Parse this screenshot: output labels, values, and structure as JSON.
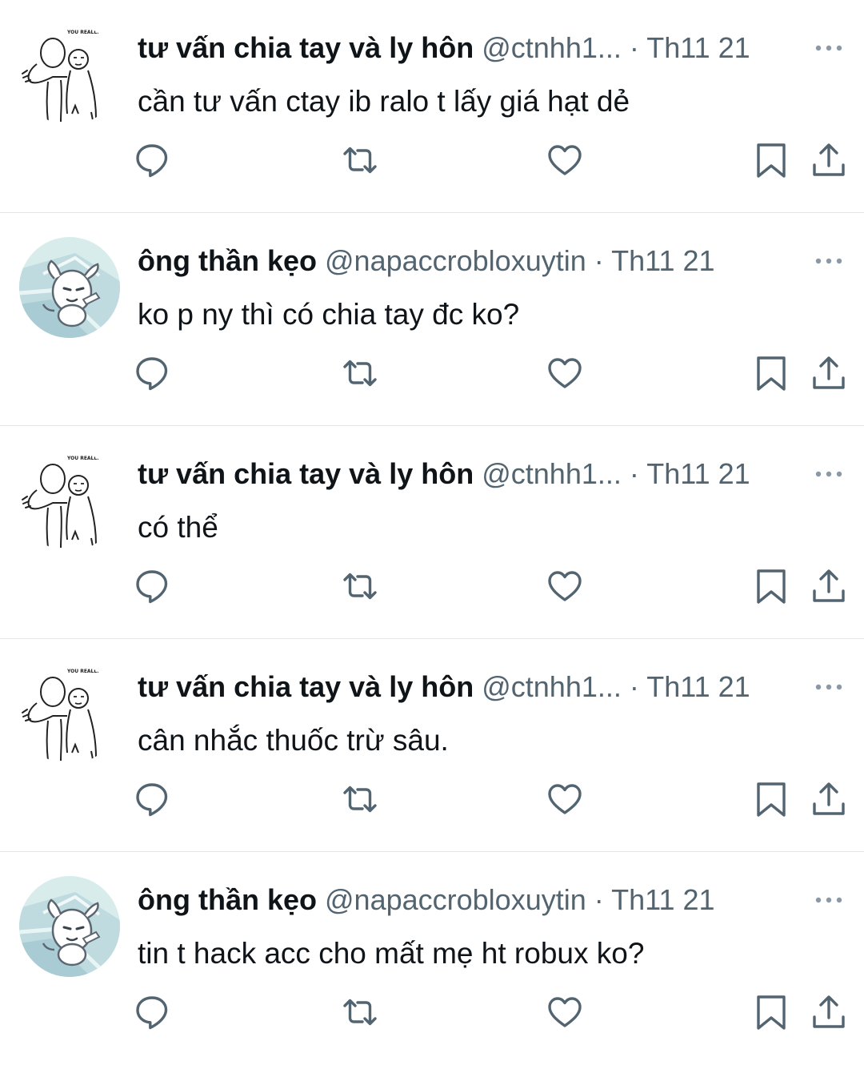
{
  "tweets": [
    {
      "author": "tư vấn chia tay và ly hôn",
      "handle": "@ctnhh1...",
      "separator": "·",
      "date": "Th11 21",
      "text": "cần tư vấn ctay ib ralo t lấy giá hạt dẻ",
      "avatar": "meme-sketch",
      "avatar_caption": "YOU REALLY"
    },
    {
      "author": "ông thần kẹo",
      "handle": "@napaccrobloxuytin",
      "separator": "·",
      "date": "Th11 21",
      "text": "ko p ny thì có chia tay đc ko?",
      "avatar": "cartoon-dog"
    },
    {
      "author": "tư vấn chia tay và ly hôn",
      "handle": "@ctnhh1...",
      "separator": "·",
      "date": "Th11 21",
      "text": "có thể",
      "avatar": "meme-sketch",
      "avatar_caption": "YOU REALLY"
    },
    {
      "author": "tư vấn chia tay và ly hôn",
      "handle": "@ctnhh1...",
      "separator": "·",
      "date": "Th11 21",
      "text": "cân nhắc thuốc trừ sâu.",
      "avatar": "meme-sketch",
      "avatar_caption": "YOU REALLY"
    },
    {
      "author": "ông thần kẹo",
      "handle": "@napaccrobloxuytin",
      "separator": "·",
      "date": "Th11 21",
      "text": "tin t hack acc cho mất mẹ ht robux ko?",
      "avatar": "cartoon-dog"
    }
  ],
  "icons": {
    "more": "more-horizontal-icon",
    "reply": "reply-icon",
    "retweet": "retweet-icon",
    "like": "heart-icon",
    "bookmark": "bookmark-icon",
    "share": "share-icon"
  },
  "colors": {
    "text": "#0f1419",
    "secondary": "#536471",
    "divider": "#e3e6e9",
    "icon": "#536471"
  }
}
